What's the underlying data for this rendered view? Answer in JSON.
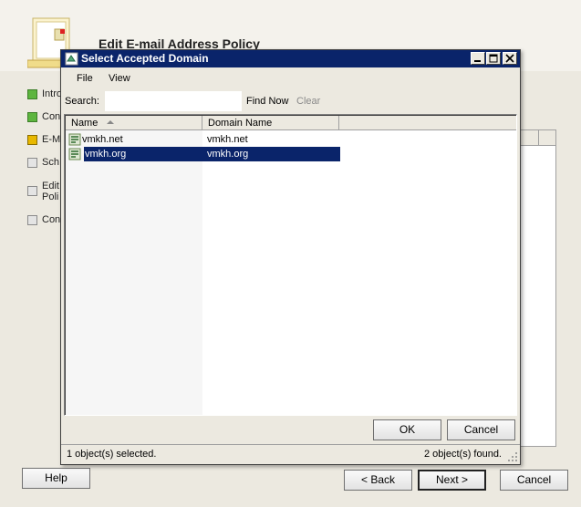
{
  "wizard": {
    "title": "Edit E-mail Address Policy",
    "steps": [
      {
        "label": "Intro",
        "state": "done"
      },
      {
        "label": "Con",
        "state": "done"
      },
      {
        "label": "E-M",
        "state": "current"
      },
      {
        "label": "Sch",
        "state": "todo"
      },
      {
        "label": "Edit",
        "label2": "Poli",
        "state": "todo"
      },
      {
        "label": "Con",
        "state": "todo"
      }
    ],
    "buttons": {
      "help": "Help",
      "back": "< Back",
      "next": "Next >",
      "cancel": "Cancel"
    }
  },
  "dialog": {
    "title": "Select Accepted Domain",
    "menu": [
      "File",
      "View"
    ],
    "search": {
      "label": "Search:",
      "value": "",
      "find_now": "Find Now",
      "clear": "Clear"
    },
    "columns": [
      "Name",
      "Domain Name"
    ],
    "rows": [
      {
        "name": "vmkh.net",
        "domain": "vmkh.net",
        "selected": false
      },
      {
        "name": "vmkh.org",
        "domain": "vmkh.org",
        "selected": true
      }
    ],
    "buttons": {
      "ok": "OK",
      "cancel": "Cancel"
    },
    "status": {
      "selected": "1 object(s) selected.",
      "found": "2 object(s) found."
    }
  },
  "colors": {
    "titlebar": "#0a246a",
    "selection": "#0a246a",
    "window_bg": "#ece9e0"
  }
}
